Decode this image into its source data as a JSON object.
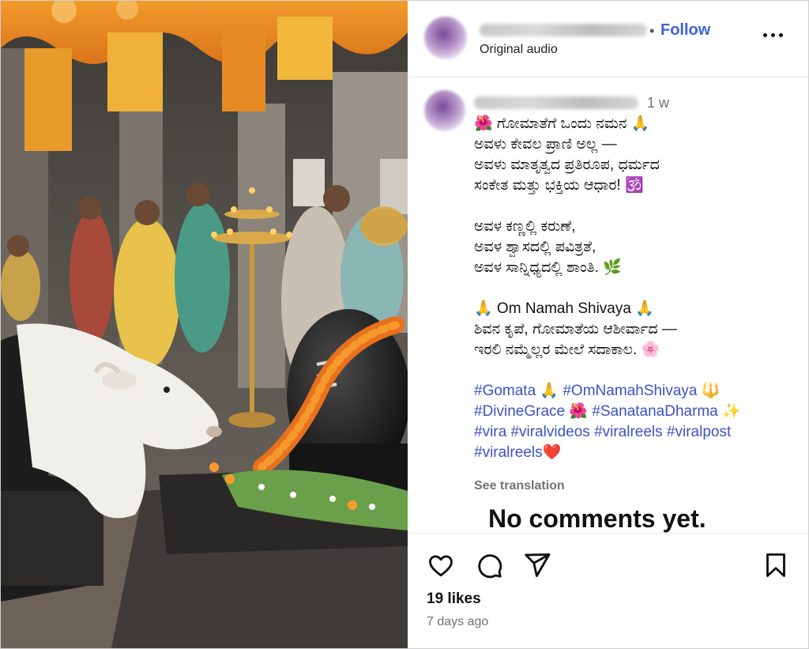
{
  "post": {
    "header": {
      "follow_label": "Follow",
      "dot": "•",
      "audio_label": "Original audio"
    },
    "caption": {
      "time": "1 w",
      "lines_kannada_1": [
        "🌺 ಗೋಮಾತೆಗೆ ಒಂದು ನಮನ 🙏",
        "ಅವಳು ಕೇವಲ ಪ್ರಾಣಿ ಅಲ್ಲ —",
        "ಅವಳು ಮಾತೃತ್ವದ ಪ್ರತಿರೂಪ, ಧರ್ಮದ",
        "ಸಂಕೇತ ಮತ್ತು ಭಕ್ತಿಯ ಆಧಾರ! 🕉️"
      ],
      "lines_kannada_2": [
        "ಅವಳ ಕಣ್ಣಲ್ಲಿ ಕರುಣೆ,",
        "ಅವಳ ಶ್ವಾಸದಲ್ಲಿ ಪವಿತ್ರತೆ,",
        "ಅವಳ ಸಾನ್ನಿಧ್ಯದಲ್ಲಿ ಶಾಂತಿ. 🌿"
      ],
      "lines_kannada_3": [
        "🙏 Om Namah Shivaya 🙏",
        "ಶಿವನ ಕೃಪೆ, ಗೋಮಾತೆಯ ಆಶೀರ್ವಾದ —",
        "ಇರಲಿ ನಮ್ಮೆಲ್ಲರ ಮೇಲೆ ಸದಾಕಾಲ. 🌸"
      ],
      "hashtag_lines": [
        "#Gomata 🙏 #OmNamahShivaya 🔱",
        "#DivineGrace 🌺 #SanatanaDharma ✨",
        "#vira #viralvideos #viralreels #viralpost",
        "#viralreels❤️"
      ],
      "see_translation": "See translation"
    },
    "comments_empty": "No comments yet.",
    "actions": {
      "like_icon": "heart-icon",
      "comment_icon": "comment-icon",
      "share_icon": "share-icon",
      "save_icon": "bookmark-icon"
    },
    "likes": "19 likes",
    "posted_ago": "7 days ago",
    "colors": {
      "link": "#3d62db",
      "hashtag": "#3d52c8",
      "muted": "#737373"
    }
  }
}
